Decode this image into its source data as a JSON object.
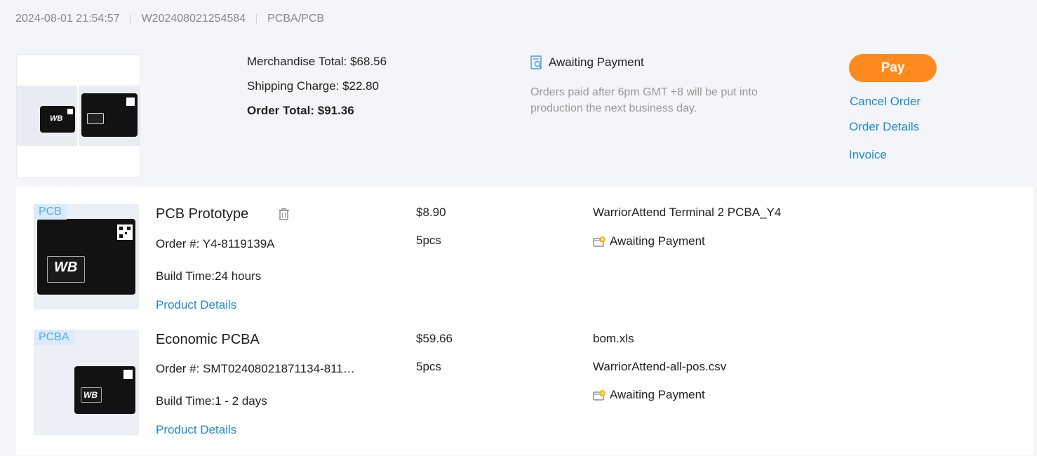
{
  "order": {
    "created_at": "2024-08-01 21:54:57",
    "order_id": "W202408021254584",
    "order_type": "PCBA/PCB"
  },
  "summary": {
    "merchandise_total": "Merchandise Total: $68.56",
    "shipping_charge": "Shipping Charge: $22.80",
    "order_total": "Order Total: $91.36",
    "status": "Awaiting Payment",
    "note": "Orders paid after 6pm GMT +8 will be put into production the next business day."
  },
  "actions": {
    "pay": "Pay",
    "cancel": "Cancel Order",
    "details": "Order Details",
    "invoice": "Invoice"
  },
  "items": [
    {
      "tag": "PCB",
      "name": "PCB Prototype",
      "order_no": "Order #: Y4-8119139A",
      "build_time": "Build Time:24 hours",
      "details_link": "Product Details",
      "price": "$8.90",
      "qty": "5pcs",
      "file": "WarriorAttend Terminal 2 PCBA_Y4",
      "status": "Awaiting Payment"
    },
    {
      "tag": "PCBA",
      "name": "Economic PCBA",
      "order_no": "Order #: SMT02408021871134-811…",
      "build_time": "Build Time:1 - 2 days",
      "details_link": "Product Details",
      "price": "$59.66",
      "qty": "5pcs",
      "file": "bom.xls",
      "file2": "WarriorAttend-all-pos.csv",
      "status": "Awaiting Payment"
    }
  ],
  "board_text": "WB",
  "colors": {
    "accent": "#ff8a1f",
    "link": "#1e88d6",
    "tag_bg": "#d9ebfd",
    "tag_text": "#5aa9ee"
  },
  "icons": {
    "status_top": "document-search-icon",
    "status_item": "wallet-clock-icon",
    "delete": "trash-icon"
  }
}
